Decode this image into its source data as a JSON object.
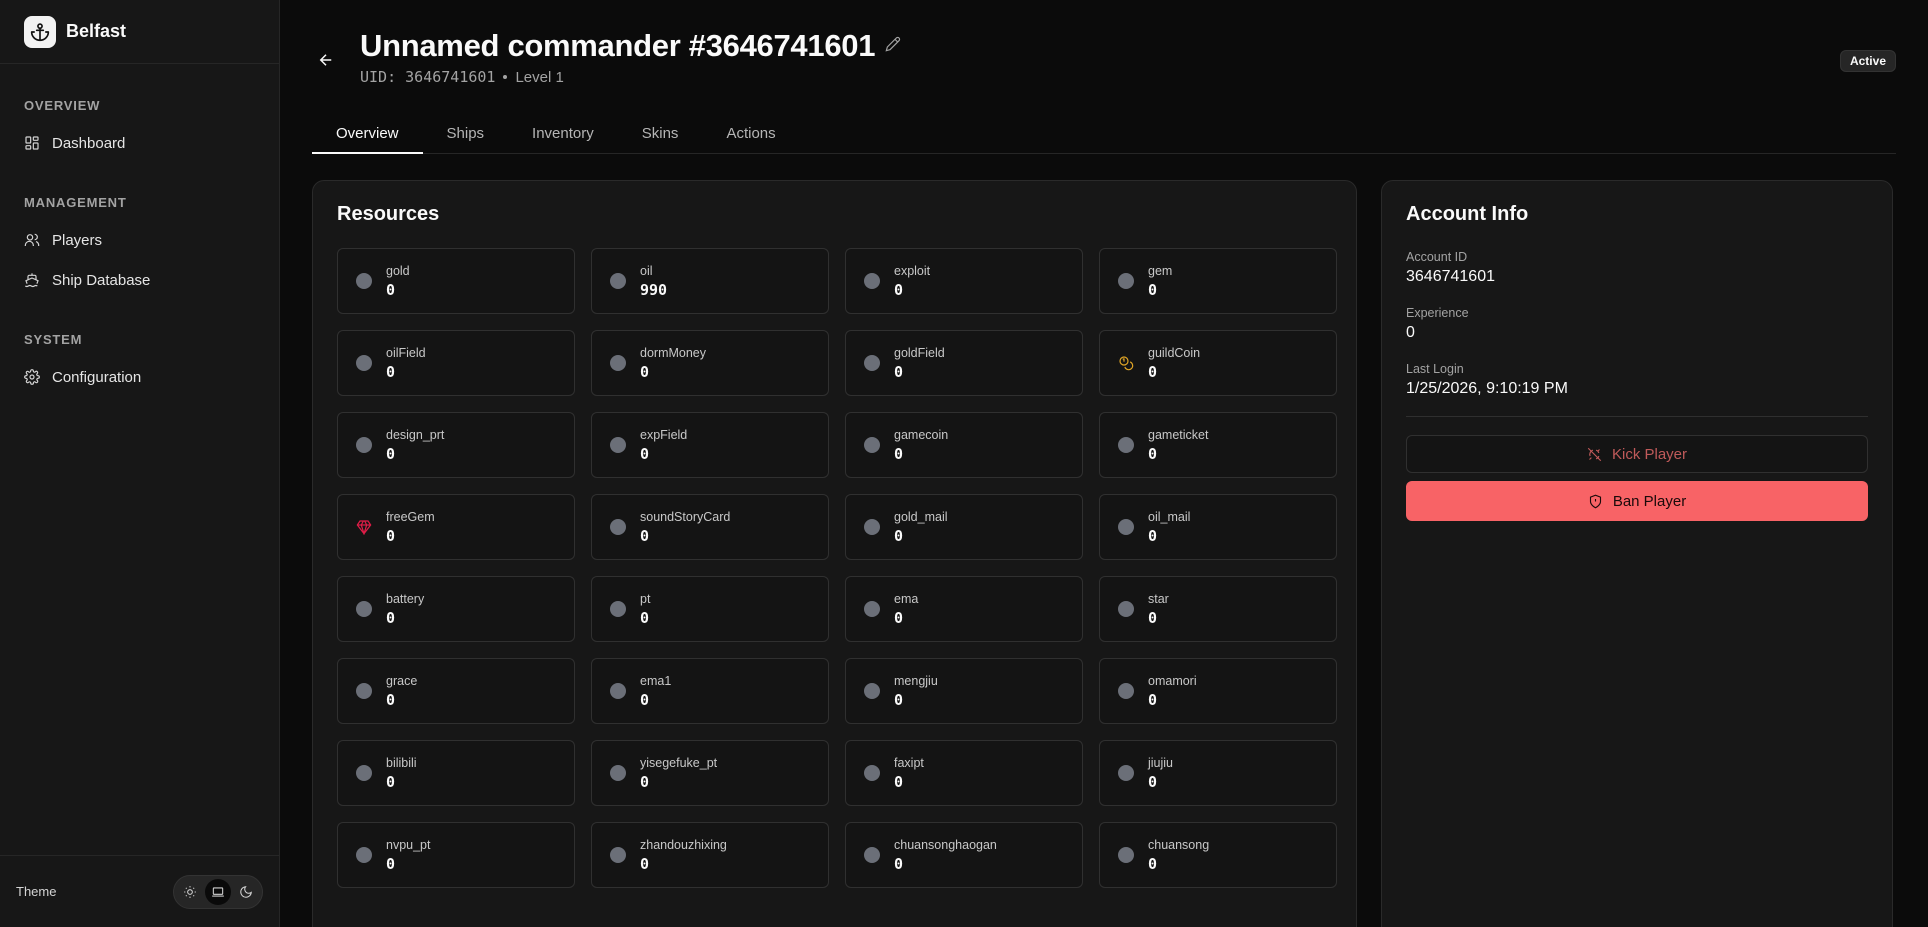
{
  "app": {
    "name": "Belfast"
  },
  "sidebar": {
    "sections": [
      {
        "heading": "OVERVIEW",
        "items": [
          {
            "label": "Dashboard",
            "icon": "dashboard-icon"
          }
        ]
      },
      {
        "heading": "MANAGEMENT",
        "items": [
          {
            "label": "Players",
            "icon": "users-icon"
          },
          {
            "label": "Ship Database",
            "icon": "ship-icon"
          }
        ]
      },
      {
        "heading": "SYSTEM",
        "items": [
          {
            "label": "Configuration",
            "icon": "gear-icon"
          }
        ]
      }
    ],
    "footer": {
      "theme_label": "Theme",
      "theme_options": [
        "light",
        "system",
        "dark"
      ],
      "theme_selected": "system"
    }
  },
  "header": {
    "title": "Unnamed commander #3646741601",
    "uid": "UID: 3646741601",
    "level": "Level 1",
    "status": "Active"
  },
  "tabs": [
    {
      "label": "Overview",
      "active": true
    },
    {
      "label": "Ships",
      "active": false
    },
    {
      "label": "Inventory",
      "active": false
    },
    {
      "label": "Skins",
      "active": false
    },
    {
      "label": "Actions",
      "active": false
    }
  ],
  "resources": {
    "title": "Resources",
    "items": [
      {
        "name": "gold",
        "value": "0",
        "icon": "dot"
      },
      {
        "name": "oil",
        "value": "990",
        "icon": "dot"
      },
      {
        "name": "exploit",
        "value": "0",
        "icon": "dot"
      },
      {
        "name": "gem",
        "value": "0",
        "icon": "dot"
      },
      {
        "name": "oilField",
        "value": "0",
        "icon": "dot"
      },
      {
        "name": "dormMoney",
        "value": "0",
        "icon": "dot"
      },
      {
        "name": "goldField",
        "value": "0",
        "icon": "dot"
      },
      {
        "name": "guildCoin",
        "value": "0",
        "icon": "coins-icon"
      },
      {
        "name": "design_prt",
        "value": "0",
        "icon": "dot"
      },
      {
        "name": "expField",
        "value": "0",
        "icon": "dot"
      },
      {
        "name": "gamecoin",
        "value": "0",
        "icon": "dot"
      },
      {
        "name": "gameticket",
        "value": "0",
        "icon": "dot"
      },
      {
        "name": "freeGem",
        "value": "0",
        "icon": "gem-icon"
      },
      {
        "name": "soundStoryCard",
        "value": "0",
        "icon": "dot"
      },
      {
        "name": "gold_mail",
        "value": "0",
        "icon": "dot"
      },
      {
        "name": "oil_mail",
        "value": "0",
        "icon": "dot"
      },
      {
        "name": "battery",
        "value": "0",
        "icon": "dot"
      },
      {
        "name": "pt",
        "value": "0",
        "icon": "dot"
      },
      {
        "name": "ema",
        "value": "0",
        "icon": "dot"
      },
      {
        "name": "star",
        "value": "0",
        "icon": "dot"
      },
      {
        "name": "grace",
        "value": "0",
        "icon": "dot"
      },
      {
        "name": "ema1",
        "value": "0",
        "icon": "dot"
      },
      {
        "name": "mengjiu",
        "value": "0",
        "icon": "dot"
      },
      {
        "name": "omamori",
        "value": "0",
        "icon": "dot"
      },
      {
        "name": "bilibili",
        "value": "0",
        "icon": "dot"
      },
      {
        "name": "yisegefuke_pt",
        "value": "0",
        "icon": "dot"
      },
      {
        "name": "faxipt",
        "value": "0",
        "icon": "dot"
      },
      {
        "name": "jiujiu",
        "value": "0",
        "icon": "dot"
      },
      {
        "name": "nvpu_pt",
        "value": "0",
        "icon": "dot"
      },
      {
        "name": "zhandouzhixing",
        "value": "0",
        "icon": "dot"
      },
      {
        "name": "chuansonghaogan",
        "value": "0",
        "icon": "dot"
      },
      {
        "name": "chuansong",
        "value": "0",
        "icon": "dot"
      }
    ]
  },
  "account": {
    "title": "Account Info",
    "fields": [
      {
        "label": "Account ID",
        "value": "3646741601"
      },
      {
        "label": "Experience",
        "value": "0"
      },
      {
        "label": "Last Login",
        "value": "1/25/2026, 9:10:19 PM"
      }
    ],
    "kick_label": "Kick Player",
    "ban_label": "Ban Player"
  },
  "colors": {
    "danger": "#f86366",
    "guildCoin": "#e0a526",
    "freeGem": "#e11d48"
  }
}
